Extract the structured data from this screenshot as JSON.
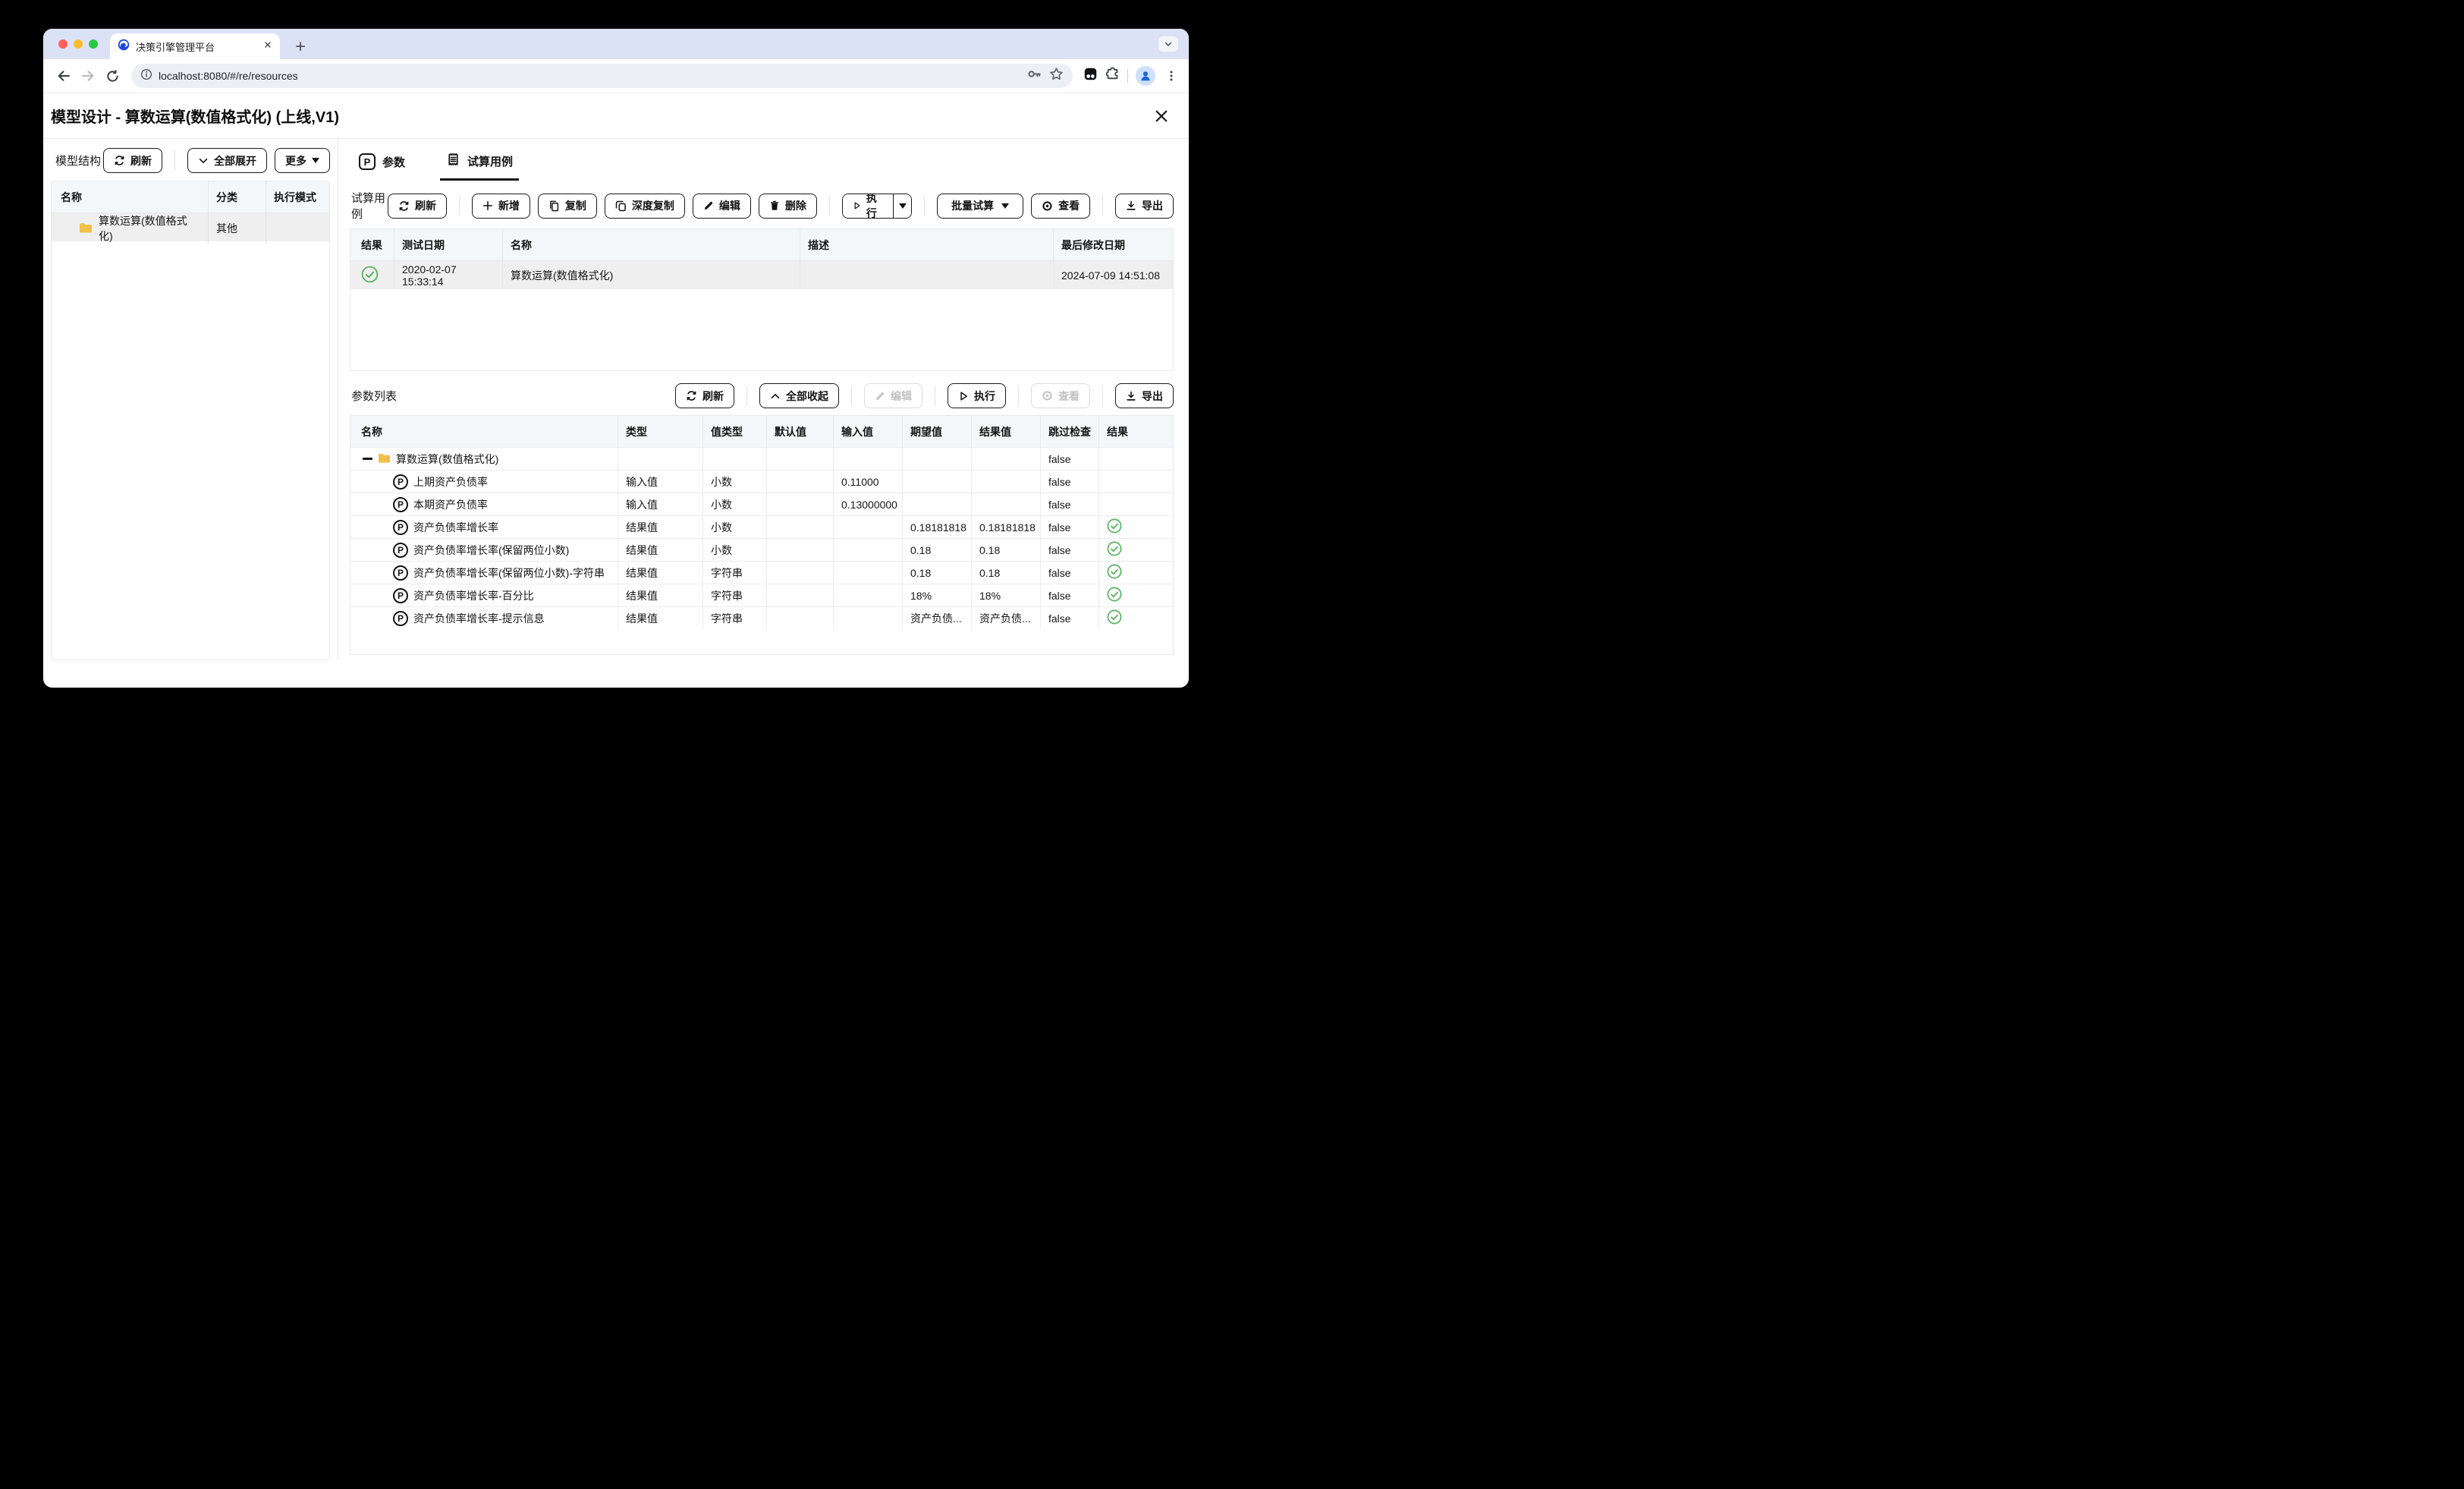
{
  "browser": {
    "tab_title": "决策引擎管理平台",
    "url": "localhost:8080/#/re/resources"
  },
  "page": {
    "title": "模型设计 - 算数运算(数值格式化) (上线,V1)"
  },
  "icons": {
    "param_badge": "P"
  },
  "left_panel": {
    "title": "模型结构",
    "buttons": {
      "refresh": "刷新",
      "expand_all": "全部展开",
      "more": "更多"
    },
    "table": {
      "headers": [
        "名称",
        "分类",
        "执行模式"
      ],
      "rows": [
        {
          "name": "算数运算(数值格式化)",
          "category": "其他",
          "exec_mode": ""
        }
      ]
    }
  },
  "tabs": {
    "params": "参数",
    "test_cases": "试算用例"
  },
  "test_case_panel": {
    "title": "试算用例",
    "buttons": {
      "refresh": "刷新",
      "add": "新增",
      "copy": "复制",
      "deep_copy": "深度复制",
      "edit": "编辑",
      "delete": "删除",
      "execute": "执行",
      "batch_test": "批量试算",
      "view": "查看",
      "export": "导出"
    },
    "table": {
      "headers": [
        "结果",
        "测试日期",
        "名称",
        "描述",
        "最后修改日期"
      ],
      "rows": [
        {
          "result": "success",
          "test_date": "2020-02-07 15:33:14",
          "name": "算数运算(数值格式化)",
          "description": "",
          "last_modified": "2024-07-09 14:51:08"
        }
      ]
    }
  },
  "param_panel": {
    "title": "参数列表",
    "buttons": {
      "refresh": "刷新",
      "collapse_all": "全部收起",
      "edit": "编辑",
      "execute": "执行",
      "view": "查看",
      "export": "导出"
    },
    "table": {
      "headers": [
        "名称",
        "类型",
        "值类型",
        "默认值",
        "输入值",
        "期望值",
        "结果值",
        "跳过检查",
        "结果"
      ],
      "rows": [
        {
          "name": "算数运算(数值格式化)",
          "type": "",
          "value_type": "",
          "default": "",
          "input": "",
          "expected": "",
          "result_value": "",
          "skip_check": "false"
        },
        {
          "name": "上期资产负债率",
          "type": "输入值",
          "value_type": "小数",
          "default": "",
          "input": "0.11000",
          "expected": "",
          "result_value": "",
          "skip_check": "false"
        },
        {
          "name": "本期资产负债率",
          "type": "输入值",
          "value_type": "小数",
          "default": "",
          "input": "0.13000000",
          "expected": "",
          "result_value": "",
          "skip_check": "false"
        },
        {
          "name": "资产负债率增长率",
          "type": "结果值",
          "value_type": "小数",
          "default": "",
          "input": "",
          "expected": "0.18181818",
          "result_value": "0.18181818",
          "skip_check": "false"
        },
        {
          "name": "资产负债率增长率(保留两位小数)",
          "type": "结果值",
          "value_type": "小数",
          "default": "",
          "input": "",
          "expected": "0.18",
          "result_value": "0.18",
          "skip_check": "false"
        },
        {
          "name": "资产负债率增长率(保留两位小数)-字符串",
          "type": "结果值",
          "value_type": "字符串",
          "default": "",
          "input": "",
          "expected": "0.18",
          "result_value": "0.18",
          "skip_check": "false"
        },
        {
          "name": "资产负债率增长率-百分比",
          "type": "结果值",
          "value_type": "字符串",
          "default": "",
          "input": "",
          "expected": "18%",
          "result_value": "18%",
          "skip_check": "false"
        },
        {
          "name": "资产负债率增长率-提示信息",
          "type": "结果值",
          "value_type": "字符串",
          "default": "",
          "input": "",
          "expected": "资产负债...",
          "result_value": "资产负债...",
          "skip_check": "false"
        }
      ]
    }
  },
  "colors": {
    "folder": "#f0c14b",
    "success": "#58b25f",
    "tab_strip": "#dce2f5",
    "accent_avatar": "#1967d2"
  }
}
